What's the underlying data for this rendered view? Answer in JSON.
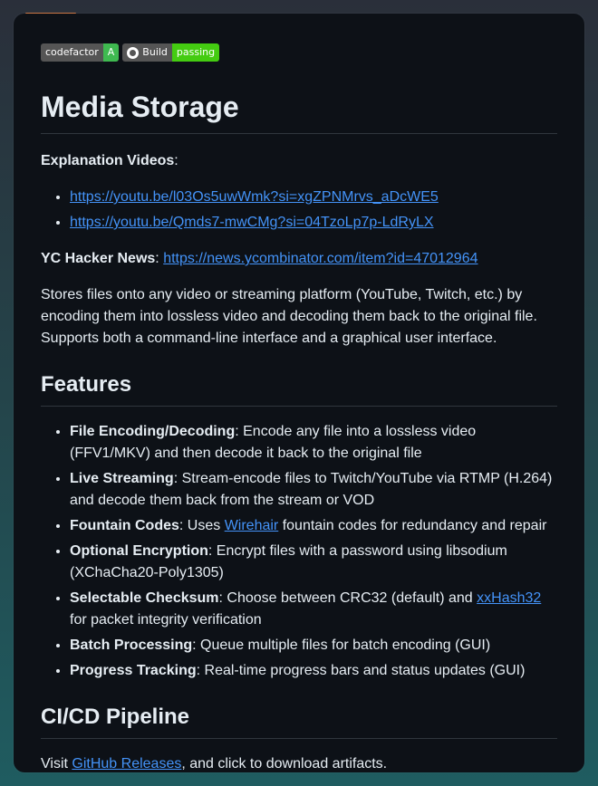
{
  "badges": [
    {
      "label": "codefactor",
      "value": "A"
    },
    {
      "label": "Build",
      "value": "passing"
    }
  ],
  "title": "Media Storage",
  "explanation": {
    "label": "Explanation Videos",
    "suffix": ":",
    "links": [
      "https://youtu.be/l03Os5uwWmk?si=xgZPNMrvs_aDcWE5",
      "https://youtu.be/Qmds7-mwCMg?si=04TzoLp7p-LdRyLX"
    ]
  },
  "yc": {
    "label": "YC Hacker News",
    "separator": ": ",
    "link": "https://news.ycombinator.com/item?id=47012964"
  },
  "description": "Stores files onto any video or streaming platform (YouTube, Twitch, etc.) by encoding them into lossless video and decoding them back to the original file. Supports both a command-line interface and a graphical user interface.",
  "features": {
    "heading": "Features",
    "items": [
      {
        "title": "File Encoding/Decoding",
        "text": ": Encode any file into a lossless video (FFV1/MKV) and then decode it back to the original file"
      },
      {
        "title": "Live Streaming",
        "text": ": Stream-encode files to Twitch/YouTube via RTMP (H.264) and decode them back from the stream or VOD"
      },
      {
        "title": "Fountain Codes",
        "pre": ": Uses ",
        "link": "Wirehair",
        "post": " fountain codes for redundancy and repair"
      },
      {
        "title": "Optional Encryption",
        "text": ": Encrypt files with a password using libsodium (XChaCha20-Poly1305)"
      },
      {
        "title": "Selectable Checksum",
        "pre": ": Choose between CRC32 (default) and ",
        "link": "xxHash32",
        "post": " for packet integrity verification"
      },
      {
        "title": "Batch Processing",
        "text": ": Queue multiple files for batch encoding (GUI)"
      },
      {
        "title": "Progress Tracking",
        "text": ": Real-time progress bars and status updates (GUI)"
      }
    ]
  },
  "cicd": {
    "heading": "CI/CD Pipeline",
    "pre": "Visit ",
    "link": "GitHub Releases",
    "post": ", and click to download artifacts."
  }
}
